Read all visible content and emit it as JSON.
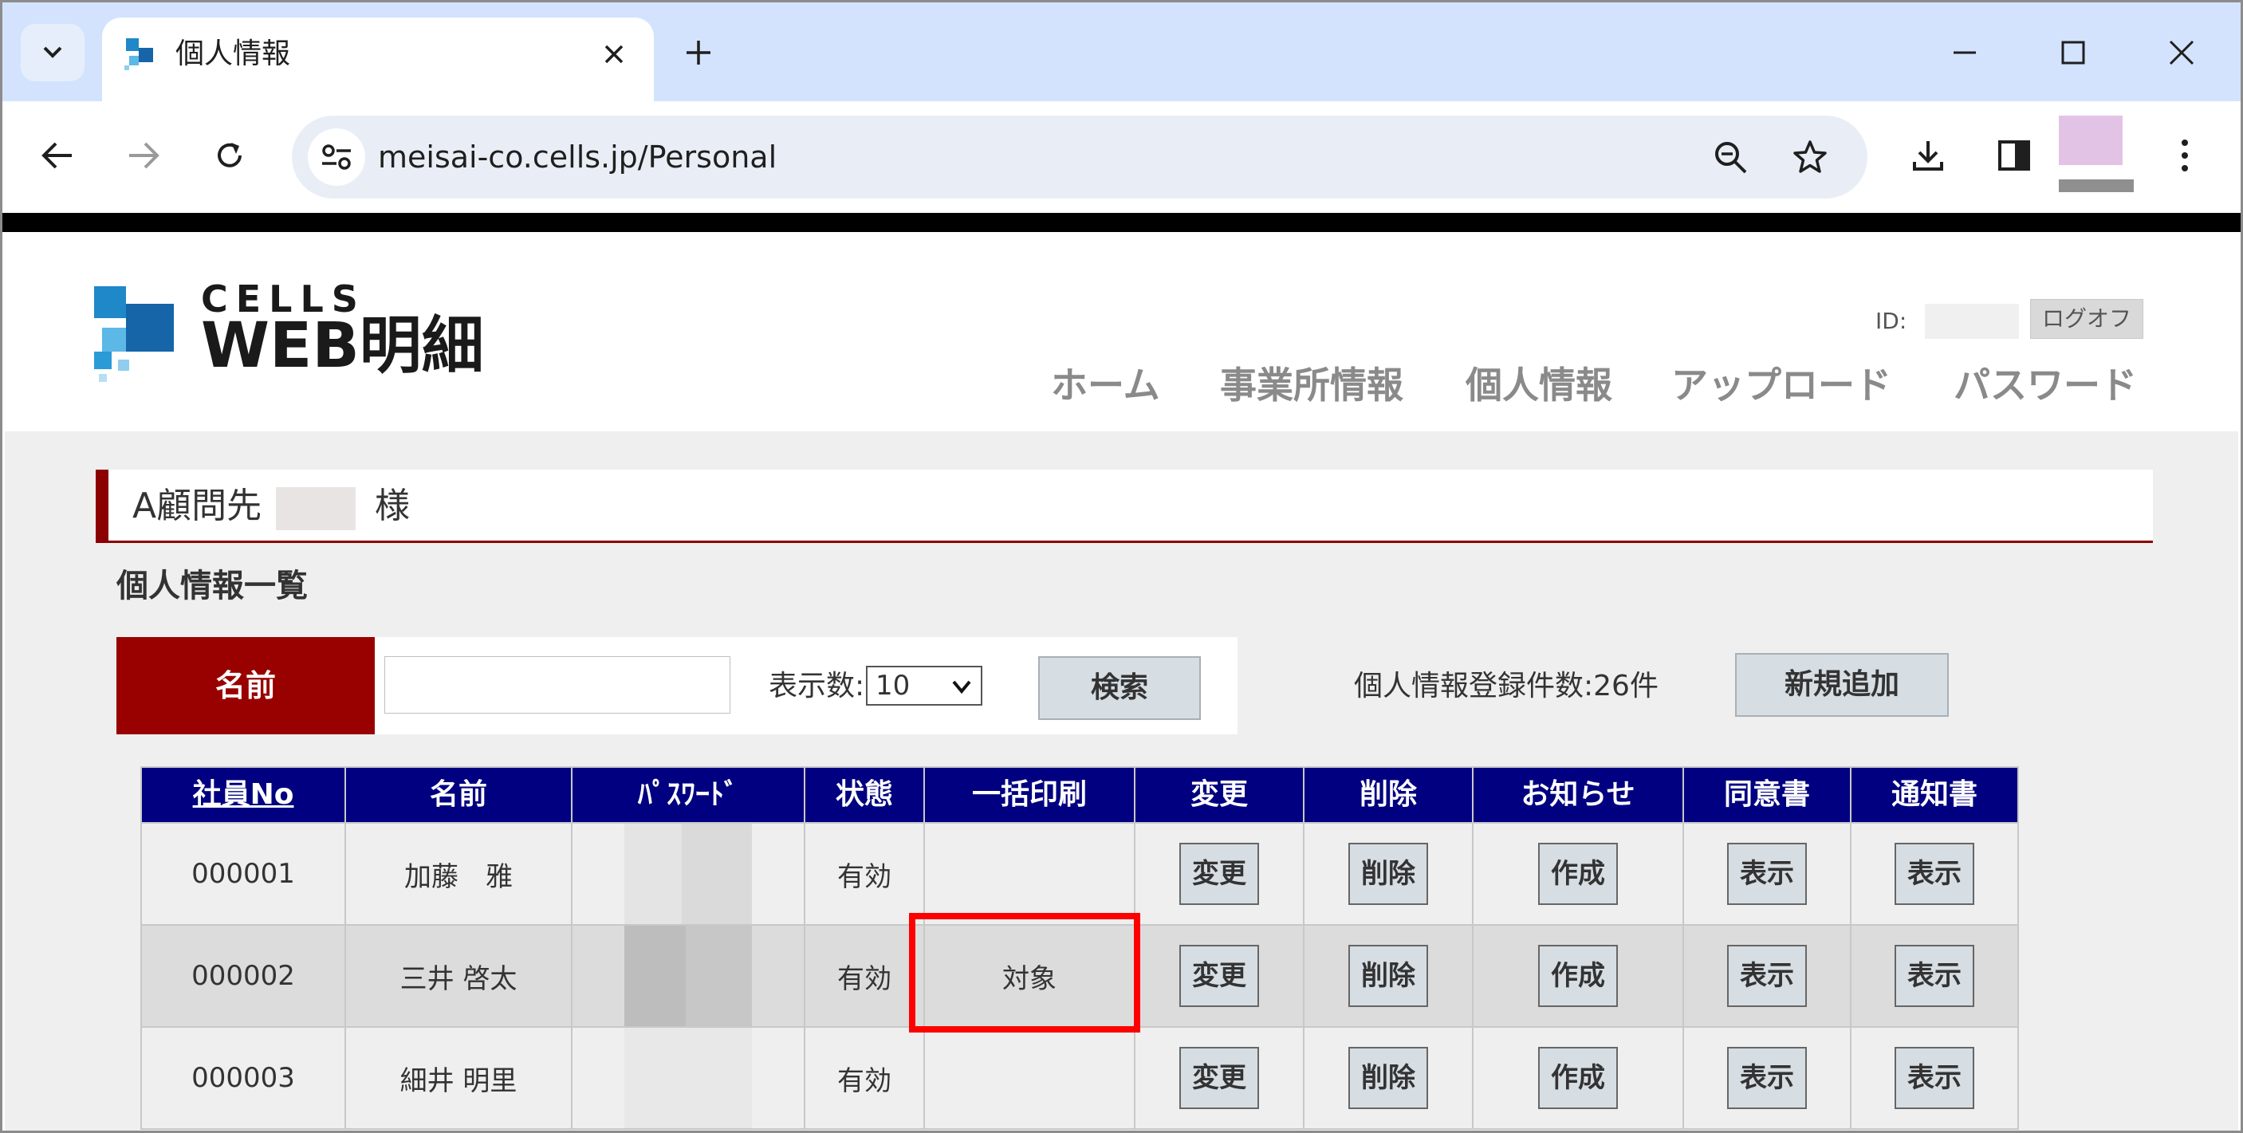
{
  "browser": {
    "tab_title": "個人情報",
    "url": "meisai-co.cells.jp/Personal",
    "icons": {
      "tab_search": "chevron-down-icon",
      "tab_close": "close-icon",
      "new_tab": "plus-icon",
      "minimize": "minimize-icon",
      "maximize": "maximize-icon",
      "close_window": "close-icon",
      "back": "arrow-left-icon",
      "forward": "arrow-right-icon",
      "reload": "reload-icon",
      "site_info": "tune-icon",
      "zoom": "zoom-icon",
      "bookmark": "star-icon",
      "download": "download-icon",
      "side_panel": "side-panel-icon",
      "menu": "kebab-menu-icon"
    }
  },
  "header": {
    "logo_top": "CELLS",
    "logo_bottom": "WEB明細",
    "id_label": "ID:",
    "logoff_label": "ログオフ",
    "nav": [
      "ホーム",
      "事業所情報",
      "個人情報",
      "アップロード",
      "パスワード"
    ]
  },
  "client": {
    "prefix": "A顧問先",
    "suffix": "様"
  },
  "main": {
    "list_title": "個人情報一覧",
    "search": {
      "name_label": "名前",
      "name_value": "",
      "count_label": "表示数:",
      "count_value": "10",
      "search_button": "検索"
    },
    "registration_count": "個人情報登録件数:26件",
    "add_button": "新規追加"
  },
  "table": {
    "headers": [
      "社員No",
      "名前",
      "ﾊﾟｽﾜｰﾄﾞ",
      "状態",
      "一括印刷",
      "変更",
      "削除",
      "お知らせ",
      "同意書",
      "通知書"
    ],
    "rows": [
      {
        "no": "000001",
        "name": "加藤　雅",
        "status": "有効",
        "bulk": "",
        "change": "変更",
        "delete": "削除",
        "notice": "作成",
        "consent": "表示",
        "notification": "表示"
      },
      {
        "no": "000002",
        "name": "三井 啓太",
        "status": "有効",
        "bulk": "対象",
        "change": "変更",
        "delete": "削除",
        "notice": "作成",
        "consent": "表示",
        "notification": "表示"
      },
      {
        "no": "000003",
        "name": "細井 明里",
        "status": "有効",
        "bulk": "",
        "change": "変更",
        "delete": "削除",
        "notice": "作成",
        "consent": "表示",
        "notification": "表示"
      }
    ]
  },
  "colors": {
    "accent_red": "#990000",
    "table_header": "#000080",
    "highlight": "#ff0000",
    "tabbar": "#d3e3fd"
  }
}
